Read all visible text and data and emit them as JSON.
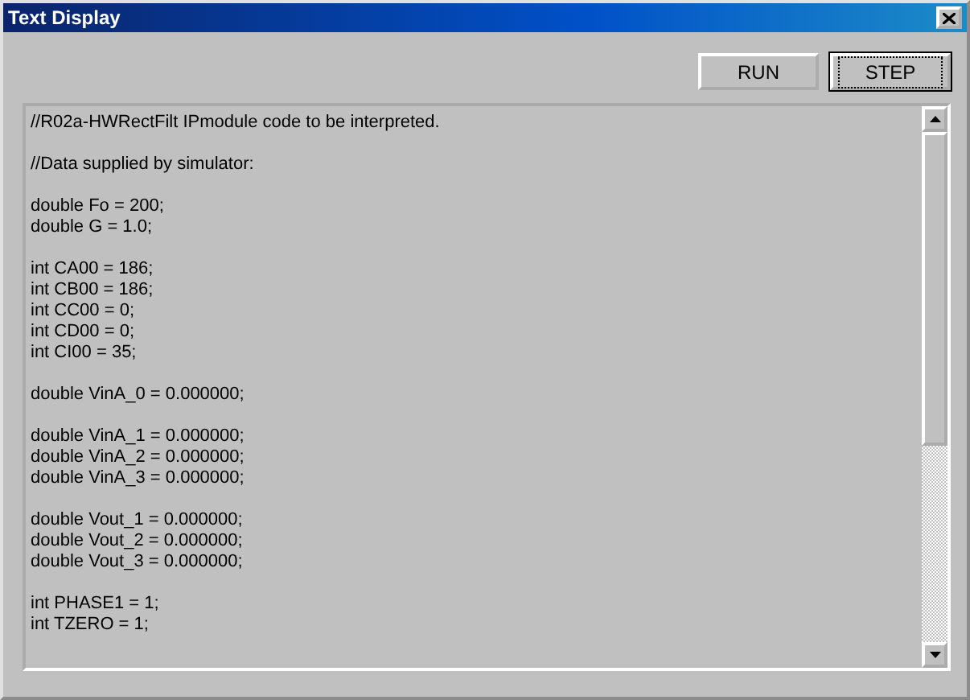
{
  "window": {
    "title": "Text Display"
  },
  "buttons": [
    {
      "label": "RUN",
      "focused": false
    },
    {
      "label": "STEP",
      "focused": true
    }
  ],
  "code_blocks": [
    [
      "//R02a-HWRectFilt IPmodule code to be interpreted."
    ],
    [
      "//Data supplied by simulator:"
    ],
    [
      "double Fo = 200;",
      "double G = 1.0;"
    ],
    [
      "int CA00 = 186;",
      "int CB00 = 186;",
      "int CC00 = 0;",
      "int CD00 = 0;",
      "int CI00 = 35;"
    ],
    [
      "double VinA_0 = 0.000000;"
    ],
    [
      "double VinA_1 = 0.000000;",
      "double VinA_2 = 0.000000;",
      "double VinA_3 = 0.000000;"
    ],
    [
      "double Vout_1 = 0.000000;",
      "double Vout_2 = 0.000000;",
      "double Vout_3 = 0.000000;"
    ],
    [
      "int PHASE1 = 1;",
      "int TZERO = 1;"
    ]
  ]
}
